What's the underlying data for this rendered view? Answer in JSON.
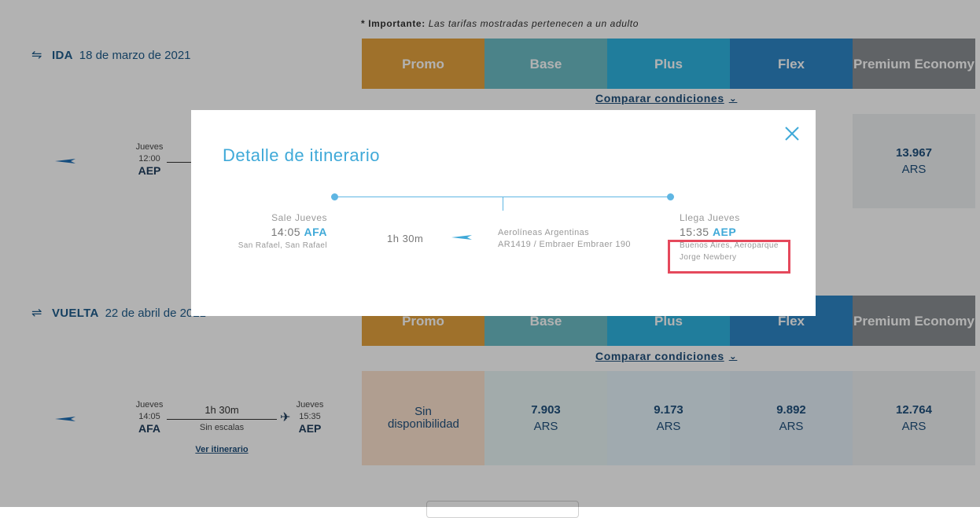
{
  "note": {
    "bold": "* Importante:",
    "italic": "Las tarifas mostradas pertenecen a un adulto"
  },
  "fare_headers": [
    {
      "label": "Promo"
    },
    {
      "label": "Base"
    },
    {
      "label": "Plus"
    },
    {
      "label": "Flex"
    },
    {
      "label": "Premium Economy"
    }
  ],
  "comparar": "Comparar condiciones",
  "ida": {
    "label": "IDA",
    "date": "18 de marzo de 2021",
    "dep_day": "Jueves",
    "dep_time": "12:00",
    "dep_code": "AEP",
    "premium_amount": "13.967",
    "premium_currency": "ARS"
  },
  "vuelta": {
    "label": "VUELTA",
    "date": "22 de abril de 2021",
    "dep_day": "Jueves",
    "dep_time": "14:05",
    "dep_code": "AFA",
    "arr_day": "Jueves",
    "arr_time": "15:35",
    "arr_code": "AEP",
    "duration": "1h 30m",
    "stops": "Sin escalas",
    "ver_itinerario": "Ver itinerario",
    "prices": [
      {
        "amount": "Sin disponibilidad",
        "currency": ""
      },
      {
        "amount": "7.903",
        "currency": "ARS"
      },
      {
        "amount": "9.173",
        "currency": "ARS"
      },
      {
        "amount": "9.892",
        "currency": "ARS"
      },
      {
        "amount": "12.764",
        "currency": "ARS"
      }
    ]
  },
  "modal": {
    "title": "Detalle de itinerario",
    "sale_label": "Sale Jueves",
    "sale_time": "14:05",
    "sale_code": "AFA",
    "sale_city": "San Rafael, San Rafael",
    "duration": "1h 30m",
    "airline": "Aerolíneas Argentinas",
    "flight": "AR1419 / Embraer Embraer 190",
    "llega_label": "Llega Jueves",
    "llega_time": "15:35",
    "llega_code": "AEP",
    "llega_city_1": "Buenos Aires, Aeroparque",
    "llega_city_2": "Jorge Newbery"
  },
  "colors": {
    "promo": "#e4a23e",
    "base": "#6cbcc4",
    "plus": "#2fb4e0",
    "flex": "#2d86c6",
    "premium": "#8a8f93",
    "accent": "#3fa9d8",
    "highlight": "#e5495c"
  }
}
